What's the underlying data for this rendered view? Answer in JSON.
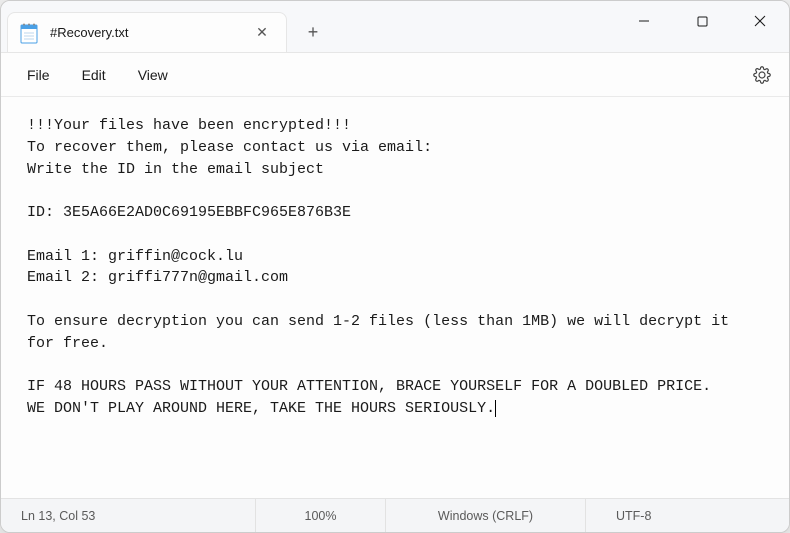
{
  "titlebar": {
    "tab_title": "#Recovery.txt",
    "close_glyph": "✕",
    "newtab_glyph": "+"
  },
  "menubar": {
    "file": "File",
    "edit": "Edit",
    "view": "View"
  },
  "editor": {
    "content": "!!!Your files have been encrypted!!!\nTo recover them, please contact us via email:\nWrite the ID in the email subject\n\nID: 3E5A66E2AD0C69195EBBFC965E876B3E\n\nEmail 1: griffin@cock.lu\nEmail 2: griffi777n@gmail.com\n\nTo ensure decryption you can send 1-2 files (less than 1MB) we will decrypt it for free.\n\nIF 48 HOURS PASS WITHOUT YOUR ATTENTION, BRACE YOURSELF FOR A DOUBLED PRICE.\nWE DON'T PLAY AROUND HERE, TAKE THE HOURS SERIOUSLY."
  },
  "statusbar": {
    "position": "Ln 13, Col 53",
    "zoom": "100%",
    "eol": "Windows (CRLF)",
    "encoding": "UTF-8"
  }
}
